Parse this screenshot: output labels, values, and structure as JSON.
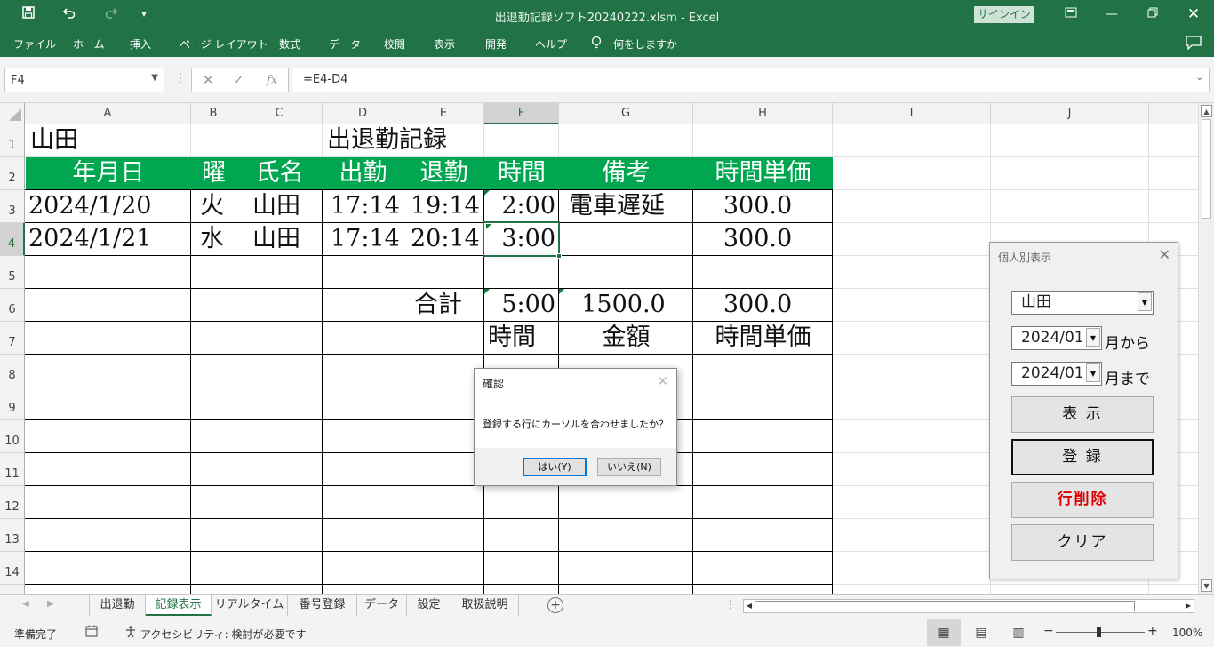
{
  "window": {
    "title": "出退勤記録ソフト20240222.xlsm  -  Excel",
    "signin": "サインイン",
    "controls": [
      "ribbon-display-icon",
      "minimize-icon",
      "restore-icon",
      "close-icon"
    ]
  },
  "quick_access": [
    "save-icon",
    "undo-icon",
    "redo-icon",
    "customize-icon"
  ],
  "ribbon": {
    "tabs": [
      "ファイル",
      "ホーム",
      "挿入",
      "ページ レイアウト",
      "数式",
      "データ",
      "校閲",
      "表示",
      "開発",
      "ヘルプ"
    ],
    "tell_me": "何をしますか"
  },
  "formula_bar": {
    "name_box": "F4",
    "formula": "=E4-D4"
  },
  "grid": {
    "columns": [
      "A",
      "B",
      "C",
      "D",
      "E",
      "F",
      "G",
      "H",
      "I",
      "J"
    ],
    "rows": [
      "1",
      "2",
      "3",
      "4",
      "5",
      "6",
      "7",
      "8",
      "9",
      "10",
      "11",
      "12",
      "13",
      "14"
    ],
    "selected_column": "F",
    "selected_row": "4",
    "cells": {
      "A1": "山田",
      "D1": "出退勤記録",
      "A2": "年月日",
      "B2": "曜",
      "C2": "氏名",
      "D2": "出勤",
      "E2": "退勤",
      "F2": "時間",
      "G2": "備考",
      "H2": "時間単価",
      "A3": "2024/1/20",
      "B3": "火",
      "C3": "山田",
      "D3": "17:14",
      "E3": "19:14",
      "F3": "2:00",
      "G3": "電車遅延",
      "H3": "300.0",
      "A4": "2024/1/21",
      "B4": "水",
      "C4": "山田",
      "D4": "17:14",
      "E4": "20:14",
      "F4": "3:00",
      "H4": "300.0",
      "E6": "合計",
      "F6": "5:00",
      "G6": "1500.0",
      "H6": "300.0",
      "F7": "時間",
      "G7": "金額",
      "H7": "時間単価"
    }
  },
  "sheets": {
    "tabs": [
      "出退勤",
      "記録表示",
      "リアルタイム",
      "番号登録",
      "データ",
      "設定",
      "取扱説明"
    ],
    "active": "記録表示"
  },
  "status": {
    "ready": "準備完了",
    "accessibility": "アクセシビリティ: 検討が必要です",
    "zoom": "100%",
    "zoom_minus": "−",
    "zoom_plus": "+"
  },
  "userform": {
    "title": "個人別表示",
    "name_value": "山田",
    "from_value": "2024/01",
    "from_label": "月から",
    "to_value": "2024/01",
    "to_label": "月まで",
    "btn_show": "表 示",
    "btn_register": "登 録",
    "btn_delete": "行削除",
    "btn_clear": "クリア"
  },
  "dialog": {
    "title": "確認",
    "message": "登録する行にカーソルを合わせましたか？",
    "yes": "はい(Y)",
    "no": "いいえ(N)"
  },
  "colors": {
    "excel_green": "#217346",
    "header_fill": "#00a650",
    "delete_text": "#dd0000"
  }
}
